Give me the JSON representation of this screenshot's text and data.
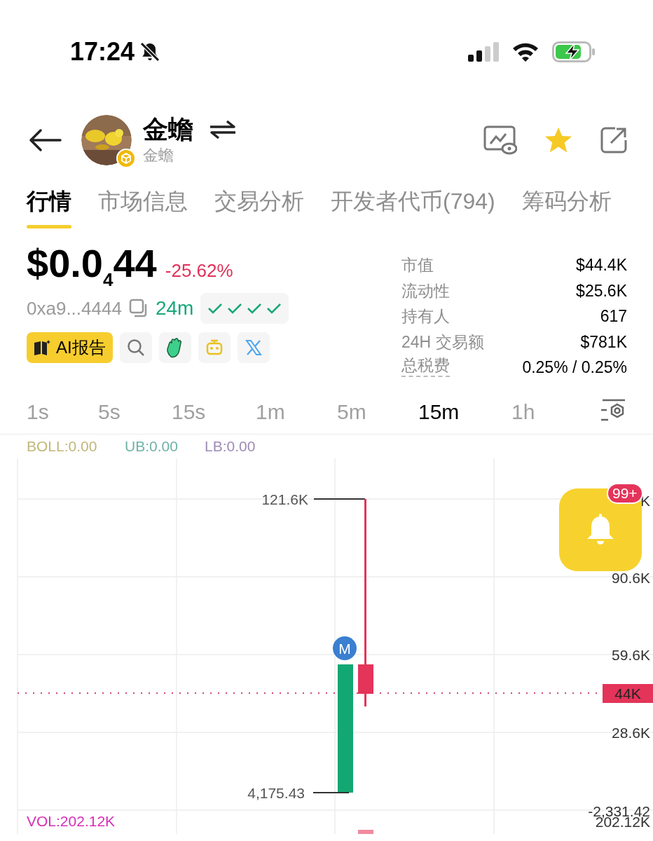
{
  "status_bar": {
    "time": "17:24"
  },
  "header": {
    "title": "金蟾",
    "subtitle": "金蟾"
  },
  "tabs": [
    {
      "label": "行情",
      "selected": true
    },
    {
      "label": "市场信息",
      "selected": false
    },
    {
      "label": "交易分析",
      "selected": false
    },
    {
      "label": "开发者代币(794)",
      "selected": false
    },
    {
      "label": "筹码分析",
      "selected": false
    }
  ],
  "price": {
    "value": "$0.0$_{4}$44",
    "change": "-25.62%"
  },
  "token": {
    "address": "0xa9...4444",
    "age": "24m"
  },
  "ai_button": {
    "label": "AI报告"
  },
  "stats": [
    {
      "label": "市值",
      "value": "$44.4K",
      "kind": "plain"
    },
    {
      "label": "流动性",
      "value": "$25.6K",
      "kind": "plain"
    },
    {
      "label": "持有人",
      "value": "617",
      "kind": "plain"
    },
    {
      "label": "24H 交易额",
      "value": "$781K",
      "kind": "plain"
    },
    {
      "label": "总税费",
      "value": "0.25% / 0.25%",
      "kind": "hint"
    }
  ],
  "timeframes": [
    {
      "label": "1s",
      "selected": false
    },
    {
      "label": "5s",
      "selected": false
    },
    {
      "label": "15s",
      "selected": false
    },
    {
      "label": "1m",
      "selected": false
    },
    {
      "label": "5m",
      "selected": false
    },
    {
      "label": "15m",
      "selected": true
    },
    {
      "label": "1h",
      "selected": false
    }
  ],
  "chart": {
    "indicators": [
      {
        "label": "BOLL:0.00",
        "color": "#c2b77a"
      },
      {
        "label": "UB:0.00",
        "color": "#6fb3a6"
      },
      {
        "label": "LB:0.00",
        "color": "#9f8bb5"
      }
    ],
    "axis_labels": [
      "K",
      "90.6K",
      "59.6K",
      "28.6K",
      "-2,331.42"
    ],
    "high_label": "121.6K",
    "low_label": "4,175.43",
    "marker": "M",
    "price_tag": "44K",
    "volume_label": "VOL:202.12K",
    "volume_axis_label": "202.12K"
  },
  "alert": {
    "badge": "99+"
  }
}
